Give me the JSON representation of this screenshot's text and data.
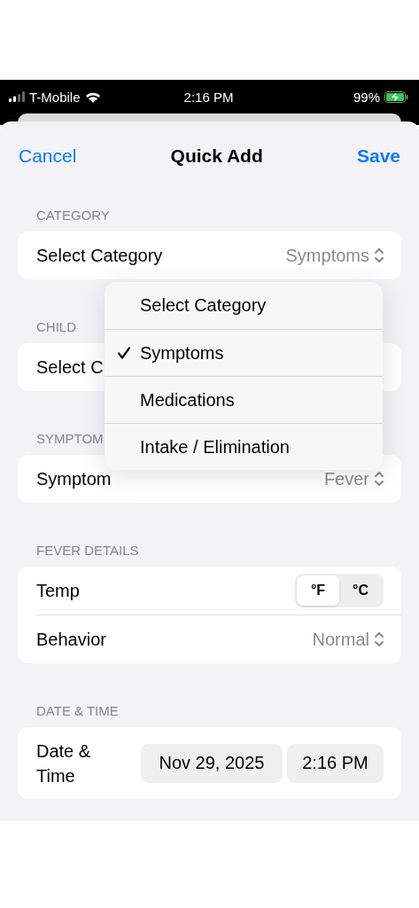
{
  "status_bar": {
    "carrier": "T-Mobile",
    "time": "2:16 PM",
    "battery": "99%"
  },
  "nav": {
    "cancel": "Cancel",
    "title": "Quick Add",
    "save": "Save"
  },
  "sections": [
    {
      "header": "CATEGORY",
      "rows": [
        {
          "kind": "picker",
          "label": "Select Category",
          "value": "Symptoms"
        }
      ]
    },
    {
      "header": "CHILD",
      "rows": [
        {
          "kind": "picker",
          "label": "Select C"
        }
      ]
    },
    {
      "header": "SYMPTOM",
      "rows": [
        {
          "kind": "picker",
          "label": "Symptom",
          "value": "Fever"
        }
      ]
    },
    {
      "header": "FEVER DETAILS",
      "rows": [
        {
          "kind": "segmented",
          "label": "Temp",
          "options": [
            {
              "label": "°F",
              "selected": true
            },
            {
              "label": "°C",
              "selected": false
            }
          ]
        },
        {
          "kind": "picker",
          "label": "Behavior",
          "value": "Normal"
        }
      ]
    },
    {
      "header": "DATE & TIME",
      "rows": [
        {
          "kind": "datetime",
          "label": "Date & Time",
          "date": "Nov 29, 2025",
          "time": "2:16 PM"
        }
      ]
    }
  ],
  "menu": {
    "options": [
      {
        "label": "Select Category",
        "selected": false
      },
      {
        "label": "Symptoms",
        "selected": true
      },
      {
        "label": "Medications",
        "selected": false
      },
      {
        "label": "Intake / Elimination",
        "selected": false
      }
    ]
  }
}
